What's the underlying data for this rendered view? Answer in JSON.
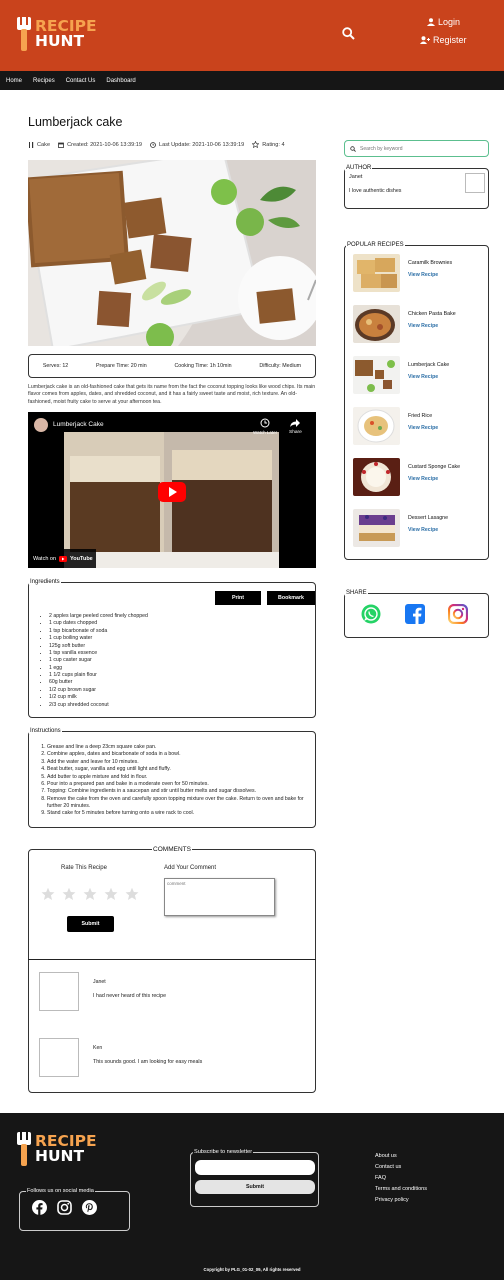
{
  "brand": {
    "line1": "RECIPE",
    "line2": "HUNT"
  },
  "header": {
    "login_label": "Login",
    "register_label": "Register"
  },
  "nav": {
    "items": [
      "Home",
      "Recipes",
      "Contact Us",
      "Dashboard"
    ]
  },
  "recipe": {
    "title": "Lumberjack cake",
    "category": "Cake",
    "created": "Created: 2021-10-06 13:39:19",
    "updated": "Last Update: 2021-10-06 13:39:19",
    "rating": "Rating: 4",
    "serves": "Serves: 12",
    "prepare_time": "Prepare Time: 20 min",
    "cooking_time": "Cooking Time: 1h 10min",
    "difficulty": "Difficulty: Medium",
    "description": "Lumberjack cake is an old-fashioned cake that gets its name from the fact the coconut topping looks like wood chips. Its main flavor comes from apples, dates, and shredded coconut, and it has a fairly sweet taste and moist, rich texture. An old-fashioned, moist fruity cake to serve at your afternoon tea."
  },
  "video": {
    "title": "Lumberjack Cake",
    "watch_later": "Watch Later",
    "share": "Share",
    "watch_on": "Watch on",
    "youtube": "YouTube"
  },
  "ingredients": {
    "legend": "Ingredients",
    "print_label": "Print",
    "bookmark_label": "Bookmark",
    "items": [
      "2 apples large peeled cored finely chopped",
      "1 cup dates chopped",
      "1 tsp bicarbonate of soda",
      "1 cup boiling water",
      "125g soft butter",
      "1 tsp vanilla essence",
      "1 cup caster sugar",
      "1 egg",
      "1 1/2 cups plain flour",
      "60g butter",
      "1/2 cup brown sugar",
      "1/2 cup milk",
      "2/3 cup shredded coconut"
    ]
  },
  "instructions": {
    "legend": "Instructions",
    "steps": [
      "Grease and line a deep 23cm square cake pan.",
      "Combine apples, dates and bicarbonate of soda in a bowl.",
      "Add the water and leave for 10 minutes.",
      "Beat butter, sugar, vanilla and egg until light and fluffy.",
      "Add butter to apple mixture and fold in flour.",
      "Pour into a prepared pan and bake in a moderate oven for 50 minutes.",
      "Topping: Combine ingredients in a saucepan and stir until butter melts and sugar dissolves.",
      "Remove the cake from the oven and carefully spoon topping mixture over the cake. Return to oven and bake for further 20 minutes.",
      "Stand cake for 5 minutes before turning onto a wire rack to cool."
    ]
  },
  "comments": {
    "legend": "COMMENTS",
    "rate_label": "Rate This Recipe",
    "add_label": "Add Your Comment",
    "placeholder": "comment",
    "submit_label": "Submit",
    "entries": [
      {
        "name": "Janet",
        "text": "I had never heard of this recipe"
      },
      {
        "name": "Ken",
        "text": "This sounds good. I am looking for easy meals"
      }
    ]
  },
  "sidebar": {
    "search_placeholder": "Search by keyword",
    "author_legend": "AUTHOR",
    "author_name": "Janet",
    "author_bio": "I love authentic dishes",
    "popular_legend": "POPULAR RECIPES",
    "view_label": "View Recipe",
    "popular": [
      {
        "title": "Caramilk Brownies"
      },
      {
        "title": "Chicken Pasta Bake"
      },
      {
        "title": "Lumberjack Cake"
      },
      {
        "title": "Fried Rice"
      },
      {
        "title": "Custard Sponge Cake"
      },
      {
        "title": "Dessert Lasagne"
      }
    ],
    "share_legend": "SHARE"
  },
  "footer": {
    "social_legend": "Follows us on social media",
    "newsletter_legend": "Subscribe to newsletter",
    "subscribe_label": "Submit",
    "links": [
      "About us",
      "Contact us",
      "FAQ",
      "Terms and conditions",
      "Privacy policy"
    ],
    "copyright": "Copyright by PLG_01-02_09, All rights reserved"
  },
  "colors": {
    "header": "#c9431c",
    "nav": "#161616",
    "brand_orange": "#f6a34f",
    "link_blue": "#2b6ea6"
  }
}
